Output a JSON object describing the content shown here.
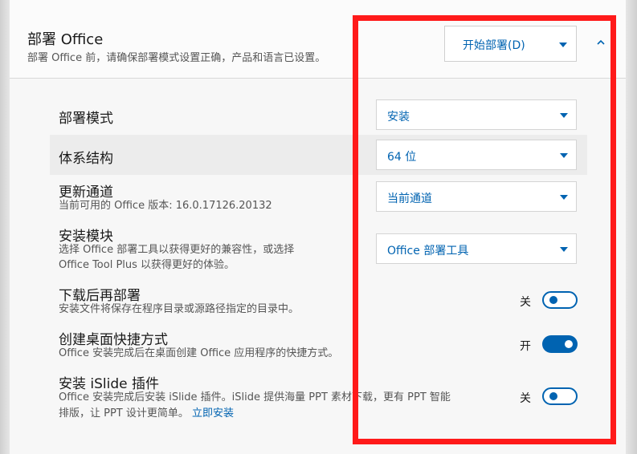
{
  "header": {
    "title": "部署 Office",
    "subtitle": "部署 Office 前，请确保部署模式设置正确，产品和语言已设置。",
    "deploy_button": "开始部署(D)"
  },
  "settings": {
    "mode": {
      "label": "部署模式",
      "value": "安装"
    },
    "arch": {
      "label": "体系结构",
      "value": "64 位"
    },
    "channel": {
      "label": "更新通道",
      "desc": "当前可用的 Office 版本: 16.0.17126.20132",
      "value": "当前通道"
    },
    "module": {
      "label": "安装模块",
      "desc_line1": "选择 Office 部署工具以获得更好的兼容性，或选择",
      "desc_line2": "Office Tool Plus 以获得更好的体验。",
      "value": "Office 部署工具"
    },
    "download_first": {
      "label": "下载后再部署",
      "desc": "安装文件将保存在程序目录或源路径指定的目录中。",
      "state_text": "关",
      "on": false
    },
    "shortcut": {
      "label": "创建桌面快捷方式",
      "desc": "Office 安装完成后在桌面创建 Office 应用程序的快捷方式。",
      "state_text": "开",
      "on": true
    },
    "islide": {
      "label": "安装 iSlide 插件",
      "desc_line1": "Office 安装完成后安装 iSlide 插件。iSlide 提供海量 PPT 素材下载，更有 PPT 智能",
      "desc_line2": "排版，让 PPT 设计更简单。",
      "link": "立即安装",
      "state_text": "关",
      "on": false
    }
  },
  "colors": {
    "accent": "#0063b1",
    "highlight_box": "#ff1a1a"
  }
}
